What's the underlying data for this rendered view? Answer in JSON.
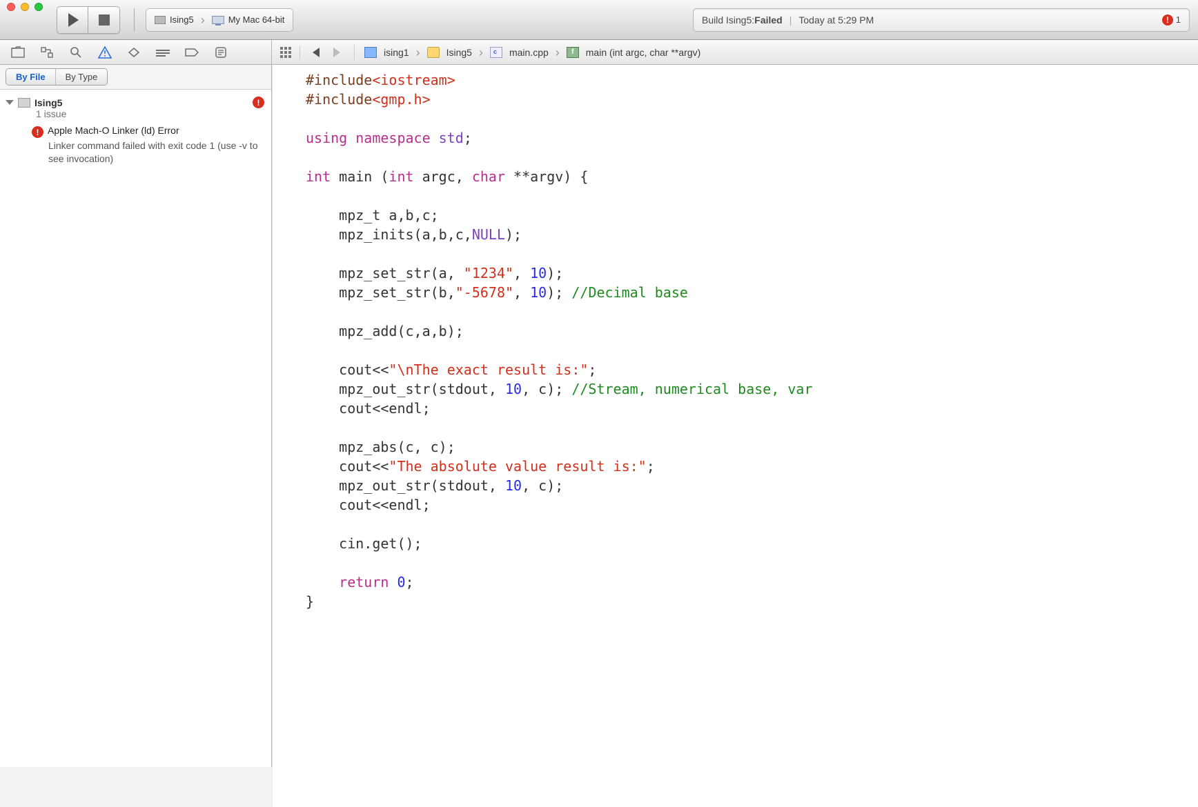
{
  "toolbar": {
    "scheme_target": "Ising5",
    "destination": "My Mac 64-bit"
  },
  "status": {
    "prefix": "Build Ising5: ",
    "result": "Failed",
    "time": "Today at 5:29 PM",
    "error_count": "1"
  },
  "filter": {
    "by_file": "By File",
    "by_type": "By Type"
  },
  "navigator": {
    "root_title": "Ising5",
    "root_sub": "1 issue",
    "issue_title": "Apple Mach-O Linker (ld) Error",
    "issue_detail": "Linker command failed with exit code 1 (use -v to see invocation)"
  },
  "jumpbar": {
    "p1": "ising1",
    "p2": "Ising5",
    "p3": "main.cpp",
    "p4": "main (int argc, char **argv)"
  },
  "code": {
    "l1a": "#include",
    "l1b": "<iostream>",
    "l2a": "#include",
    "l2b": "<gmp.h>",
    "l3": "",
    "l4a": "using",
    "l4b": " namespace",
    "l4c": " std",
    "l5": "",
    "l6a": "int",
    "l6b": " main (",
    "l6c": "int",
    "l6d": " argc, ",
    "l6e": "char",
    "l6f": " **argv) {",
    "l7": "",
    "l8": "    mpz_t a,b,c;",
    "l9a": "    mpz_inits(a,b,c,",
    "l9b": "NULL",
    "l9c": ");",
    "l10": "",
    "l11a": "    mpz_set_str(a, ",
    "l11b": "\"1234\"",
    "l11c": ", ",
    "l11d": "10",
    "l11e": ");",
    "l12a": "    mpz_set_str(b,",
    "l12b": "\"-5678\"",
    "l12c": ", ",
    "l12d": "10",
    "l12e": "); ",
    "l12f": "//Decimal base",
    "l13": "",
    "l14": "    mpz_add(c,a,b);",
    "l15": "",
    "l16a": "    cout<<",
    "l16b": "\"\\nThe exact result is:\"",
    "l16c": ";",
    "l17a": "    mpz_out_str(stdout, ",
    "l17b": "10",
    "l17c": ", c); ",
    "l17d": "//Stream, numerical base, var",
    "l18": "    cout<<endl;",
    "l19": "",
    "l20": "    mpz_abs(c, c);",
    "l21a": "    cout<<",
    "l21b": "\"The absolute value result is:\"",
    "l21c": ";",
    "l22a": "    mpz_out_str(stdout, ",
    "l22b": "10",
    "l22c": ", c);",
    "l23": "    cout<<endl;",
    "l24": "",
    "l25": "    cin.get();",
    "l26": "",
    "l27a": "    return ",
    "l27b": "0",
    "l27c": ";",
    "l28": "}"
  }
}
